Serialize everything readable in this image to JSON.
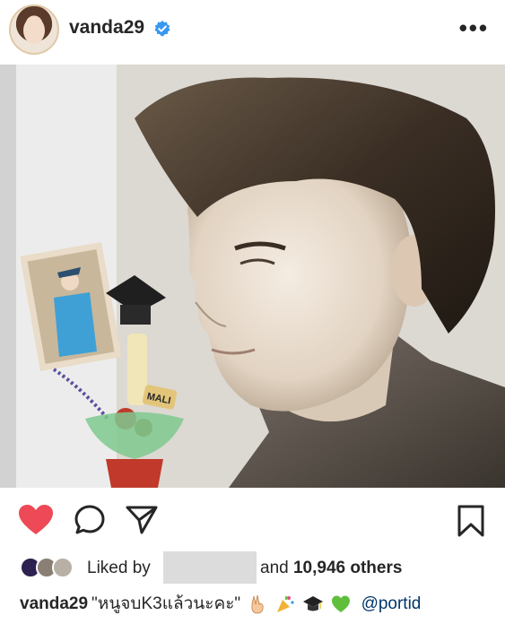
{
  "post": {
    "username": "vanda29",
    "verified_icon": "verified-badge-icon",
    "more_icon": "more-options-icon",
    "more_label": "•••"
  },
  "actions": {
    "like_icon": "heart-filled-icon",
    "comment_icon": "comment-icon",
    "share_icon": "share-icon",
    "save_icon": "bookmark-icon",
    "like_color": "#ed4956"
  },
  "likes": {
    "prefix": "Liked by",
    "and_label": "and",
    "count_label": "10,946 others"
  },
  "caption": {
    "username": "vanda29",
    "text": "\"หนูจบK3แล้วนะคะ\"",
    "emojis": [
      "victory-hand-icon",
      "party-popper-icon",
      "graduation-cap-icon",
      "green-heart-icon"
    ],
    "mention": "@portid"
  },
  "photo": {
    "small_photo_label": "MALI"
  }
}
